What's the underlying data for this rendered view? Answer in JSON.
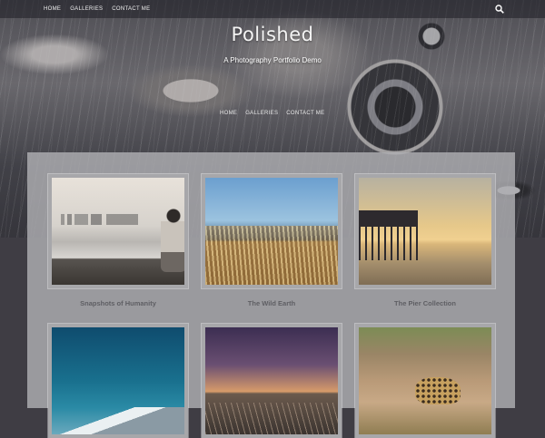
{
  "top_nav": [
    "HOME",
    "GALLERIES",
    "CONTACT ME"
  ],
  "site": {
    "title": "Polished",
    "tagline": "A Photography Portfolio Demo"
  },
  "hero_nav": [
    "HOME",
    "GALLERIES",
    "CONTACT ME"
  ],
  "galleries": [
    {
      "title": "Snapshots of Humanity"
    },
    {
      "title": "The Wild Earth"
    },
    {
      "title": "The Pier Collection"
    },
    {
      "title": ""
    },
    {
      "title": ""
    },
    {
      "title": ""
    }
  ],
  "icons": {
    "search": "search-icon"
  },
  "colors": {
    "background": "#3f3d44",
    "panel": "#afafb2",
    "caption": "#5e5e63"
  }
}
